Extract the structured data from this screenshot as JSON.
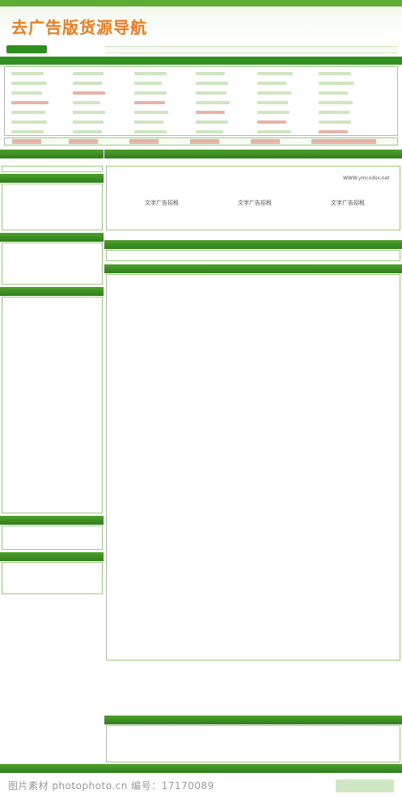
{
  "site": {
    "logo_text": "去广告版货源导航",
    "ad_banner": "文字广告招租",
    "ad_site": "WWW.ymcodsx.net"
  },
  "watermark": {
    "left": "图片素材 photophoto.cn   编号：17170089"
  },
  "colors": {
    "brand_green": "#2f8f1f",
    "logo_orange": "#f07a1c",
    "light_green": "#dff0d3",
    "border_green": "#9ccc7f"
  }
}
